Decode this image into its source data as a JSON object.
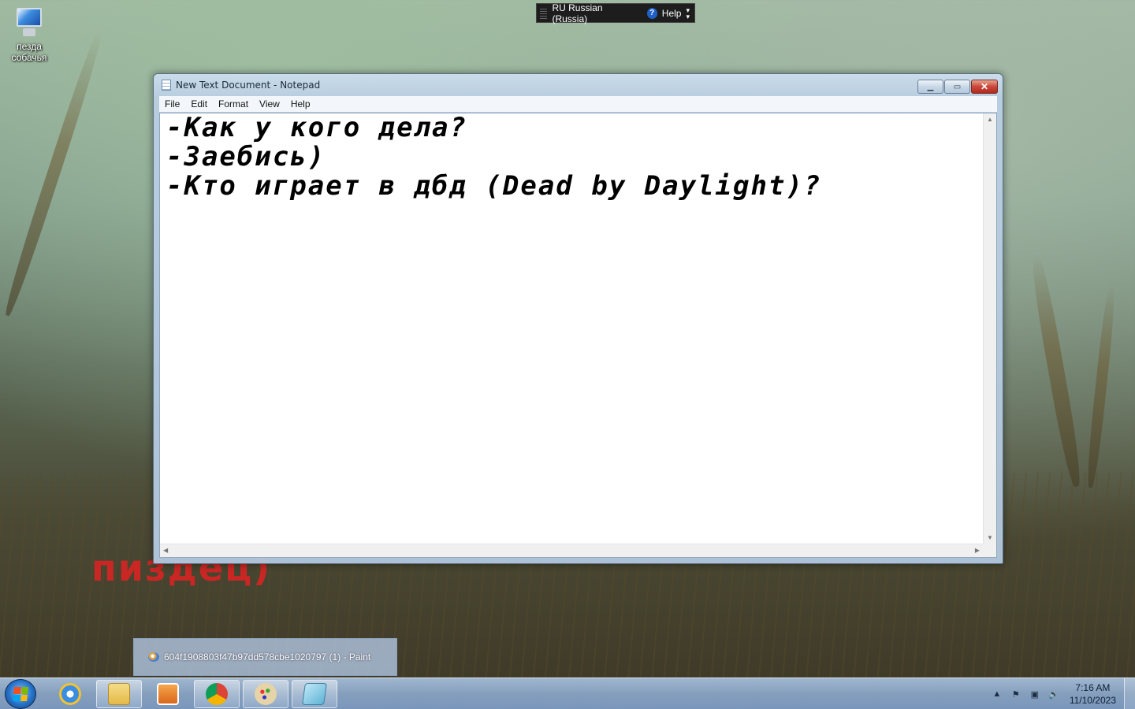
{
  "desktop": {
    "icon_label_line1": "пезда",
    "icon_label_line2": "собачья",
    "wallpaper_text": "пиздец)"
  },
  "language_bar": {
    "language": "RU Russian (Russia)",
    "help_label": "Help",
    "help_icon": "?"
  },
  "notepad": {
    "title": "New Text Document - Notepad",
    "menu": [
      "File",
      "Edit",
      "Format",
      "View",
      "Help"
    ],
    "content": "-Как у кого дела?\n-Заебись)\n-Кто играет в дбд (Dead by Daylight)?",
    "buttons": {
      "minimize": "minimize-icon",
      "maximize": "maximize-icon",
      "close": "close-icon"
    }
  },
  "taskbar": {
    "preview_label": "604f1908803f47b97dd578cbe1020797 (1) - Paint",
    "pinned": [
      "Internet Explorer",
      "Windows Explorer",
      "Media Player",
      "Google Chrome",
      "Paint",
      "Notepad"
    ],
    "time": "7:16 AM",
    "date": "11/10/2023"
  },
  "colors": {
    "wallpaper_red_text": "#e02222",
    "taskbar": "#8caacd",
    "close_button": "#c9473a"
  }
}
